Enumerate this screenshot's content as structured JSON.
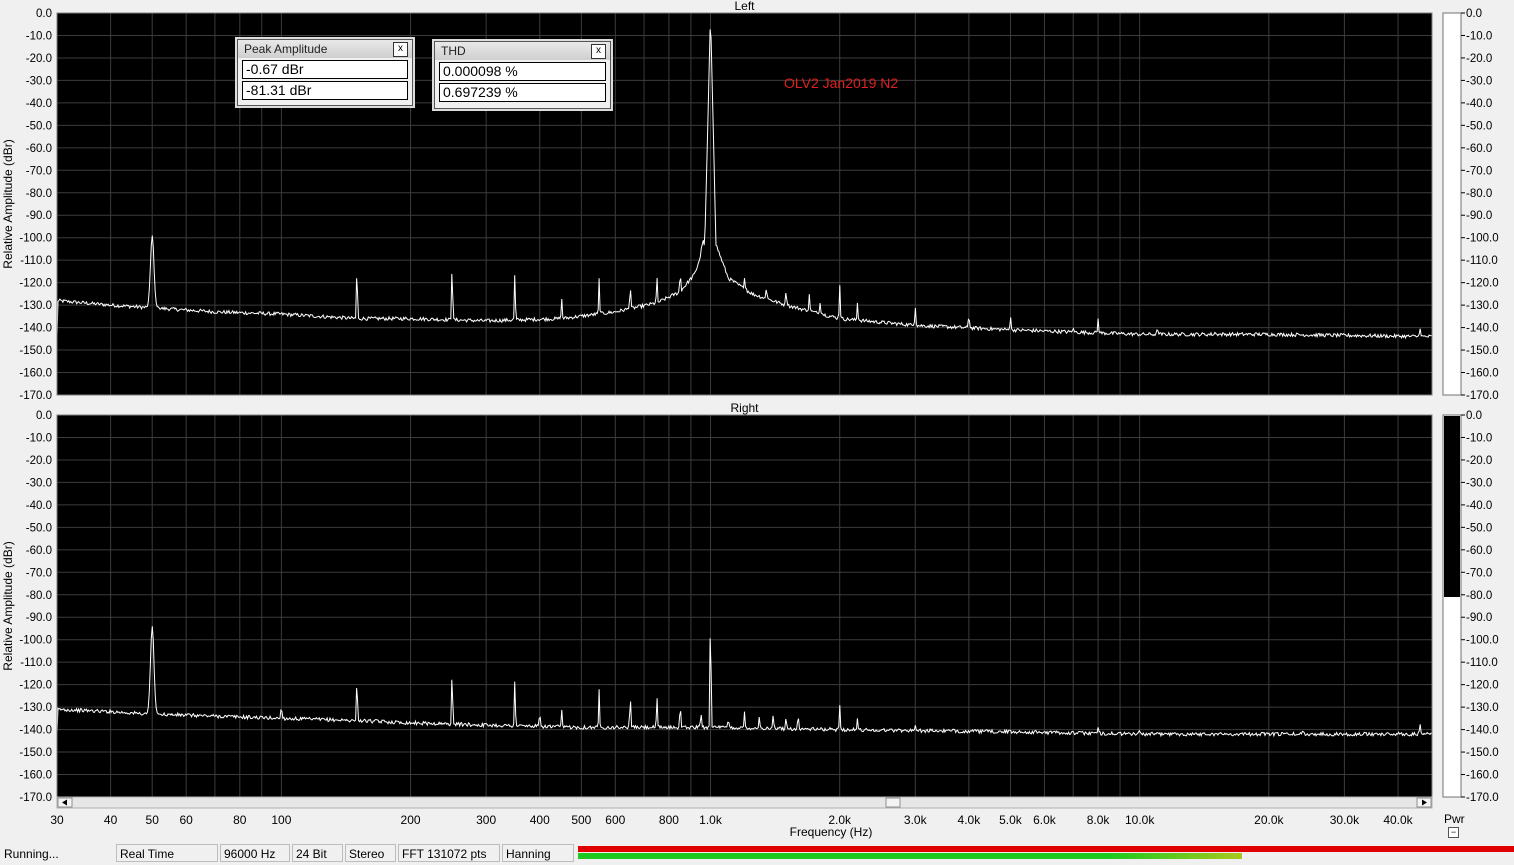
{
  "chart_data": [
    {
      "type": "line",
      "title": "Left",
      "xlabel": "Frequency (Hz)",
      "ylabel": "Relative Amplitude (dBr)",
      "xscale": "log",
      "xlim": [
        30,
        48000
      ],
      "ylim": [
        -170,
        0
      ],
      "yticks": [
        0,
        -10,
        -20,
        -30,
        -40,
        -50,
        -60,
        -70,
        -80,
        -90,
        -100,
        -110,
        -120,
        -130,
        -140,
        -150,
        -160,
        -170
      ],
      "ytick_labels": [
        "0.0",
        "-10.0",
        "-20.0",
        "-30.0",
        "-40.0",
        "-50.0",
        "-60.0",
        "-70.0",
        "-80.0",
        "-90.0",
        "-100.0",
        "-110.0",
        "-120.0",
        "-130.0",
        "-140.0",
        "-150.0",
        "-160.0",
        "-170.0"
      ],
      "grid": true,
      "annotation": "OLV2  Jan2019 N2",
      "floor": [
        [
          30,
          -128
        ],
        [
          40,
          -130
        ],
        [
          48,
          -131
        ],
        [
          70,
          -133
        ],
        [
          100,
          -134
        ],
        [
          150,
          -136
        ],
        [
          200,
          -136
        ],
        [
          300,
          -137
        ],
        [
          450,
          -136
        ],
        [
          600,
          -133
        ],
        [
          750,
          -129
        ],
        [
          850,
          -124
        ],
        [
          920,
          -116
        ],
        [
          970,
          -102
        ],
        [
          1000,
          -1
        ],
        [
          1030,
          -103
        ],
        [
          1100,
          -118
        ],
        [
          1250,
          -125
        ],
        [
          1500,
          -130
        ],
        [
          2000,
          -136
        ],
        [
          3000,
          -139
        ],
        [
          5000,
          -141
        ],
        [
          10000,
          -143
        ],
        [
          20000,
          -143
        ],
        [
          46000,
          -144
        ]
      ],
      "peaks": [
        [
          50,
          -99
        ],
        [
          150,
          -110
        ],
        [
          250,
          -110
        ],
        [
          350,
          -115
        ],
        [
          450,
          -127
        ],
        [
          550,
          -118
        ],
        [
          650,
          -121
        ],
        [
          750,
          -117
        ],
        [
          850,
          -115
        ],
        [
          960,
          -100
        ],
        [
          1200,
          -118
        ],
        [
          1350,
          -122
        ],
        [
          1500,
          -123
        ],
        [
          1700,
          -125
        ],
        [
          1800,
          -129
        ],
        [
          2000,
          -121
        ],
        [
          2200,
          -129
        ],
        [
          3000,
          -131
        ],
        [
          4000,
          -134
        ],
        [
          5000,
          -135
        ],
        [
          7000,
          -140
        ],
        [
          8000,
          -136
        ],
        [
          11000,
          -140
        ],
        [
          15000,
          -142
        ],
        [
          45000,
          -140
        ]
      ]
    },
    {
      "type": "line",
      "title": "Right",
      "xlabel": "Frequency (Hz)",
      "ylabel": "Relative Amplitude (dBr)",
      "xscale": "log",
      "xlim": [
        30,
        48000
      ],
      "ylim": [
        -170,
        0
      ],
      "yticks": [
        0,
        -10,
        -20,
        -30,
        -40,
        -50,
        -60,
        -70,
        -80,
        -90,
        -100,
        -110,
        -120,
        -130,
        -140,
        -150,
        -160,
        -170
      ],
      "ytick_labels": [
        "0.0",
        "-10.0",
        "-20.0",
        "-30.0",
        "-40.0",
        "-50.0",
        "-60.0",
        "-70.0",
        "-80.0",
        "-90.0",
        "-100.0",
        "-110.0",
        "-120.0",
        "-130.0",
        "-140.0",
        "-150.0",
        "-160.0",
        "-170.0"
      ],
      "grid": true,
      "floor": [
        [
          30,
          -131
        ],
        [
          40,
          -132
        ],
        [
          48,
          -133
        ],
        [
          70,
          -134
        ],
        [
          100,
          -135
        ],
        [
          150,
          -136
        ],
        [
          200,
          -137
        ],
        [
          300,
          -138
        ],
        [
          500,
          -139
        ],
        [
          1000,
          -139
        ],
        [
          2000,
          -140
        ],
        [
          5000,
          -141
        ],
        [
          10000,
          -142
        ],
        [
          20000,
          -142
        ],
        [
          46000,
          -142
        ]
      ],
      "peaks": [
        [
          50,
          -94
        ],
        [
          100,
          -129
        ],
        [
          150,
          -115
        ],
        [
          250,
          -112
        ],
        [
          350,
          -117
        ],
        [
          400,
          -132
        ],
        [
          450,
          -131
        ],
        [
          550,
          -122
        ],
        [
          650,
          -124
        ],
        [
          750,
          -125
        ],
        [
          850,
          -128
        ],
        [
          950,
          -132
        ],
        [
          1000,
          -82
        ],
        [
          1100,
          -135
        ],
        [
          1200,
          -132
        ],
        [
          1300,
          -134
        ],
        [
          1400,
          -133
        ],
        [
          1500,
          -134
        ],
        [
          1600,
          -133
        ],
        [
          2000,
          -129
        ],
        [
          2200,
          -135
        ],
        [
          3000,
          -138
        ],
        [
          8000,
          -139
        ],
        [
          10000,
          -140
        ],
        [
          24000,
          -140
        ],
        [
          45000,
          -137
        ]
      ]
    }
  ],
  "x_tick_labels": [
    {
      "v": 30,
      "t": "30"
    },
    {
      "v": 40,
      "t": "40"
    },
    {
      "v": 50,
      "t": "50"
    },
    {
      "v": 60,
      "t": "60"
    },
    {
      "v": 80,
      "t": "80"
    },
    {
      "v": 100,
      "t": "100"
    },
    {
      "v": 200,
      "t": "200"
    },
    {
      "v": 300,
      "t": "300"
    },
    {
      "v": 400,
      "t": "400"
    },
    {
      "v": 500,
      "t": "500"
    },
    {
      "v": 600,
      "t": "600"
    },
    {
      "v": 800,
      "t": "800"
    },
    {
      "v": 1000,
      "t": "1.0k"
    },
    {
      "v": 2000,
      "t": "2.0k"
    },
    {
      "v": 3000,
      "t": "3.0k"
    },
    {
      "v": 4000,
      "t": "4.0k"
    },
    {
      "v": 5000,
      "t": "5.0k"
    },
    {
      "v": 6000,
      "t": "6.0k"
    },
    {
      "v": 8000,
      "t": "8.0k"
    },
    {
      "v": 10000,
      "t": "10.0k"
    },
    {
      "v": 20000,
      "t": "20.0k"
    },
    {
      "v": 30000,
      "t": "30.0k"
    },
    {
      "v": 40000,
      "t": "40.0k"
    }
  ],
  "meters": [
    {
      "channel": "Left",
      "level_dbr": 0
    },
    {
      "channel": "Right",
      "level_dbr": -81
    }
  ],
  "meter_label": "Pwr",
  "peak_window": {
    "title": "Peak Amplitude",
    "values": [
      "-0.67 dBr",
      "-81.31 dBr"
    ],
    "close": "x"
  },
  "thd_window": {
    "title": "THD",
    "values": [
      "0.000098 %",
      "0.697239 %"
    ],
    "close": "x"
  },
  "status": {
    "state": "Running...",
    "mode": "Real Time",
    "rate": "96000 Hz",
    "bits": "24 Bit",
    "channels": "Stereo",
    "fft": "FFT 131072 pts",
    "window": "Hanning"
  },
  "colors": {
    "trace": "#ffffff",
    "plot_bg": "#000000",
    "grid": "#3c3c3c",
    "annotation": "#e02020",
    "meter_red": "#e00000",
    "meter_green": "#1ec81e"
  }
}
